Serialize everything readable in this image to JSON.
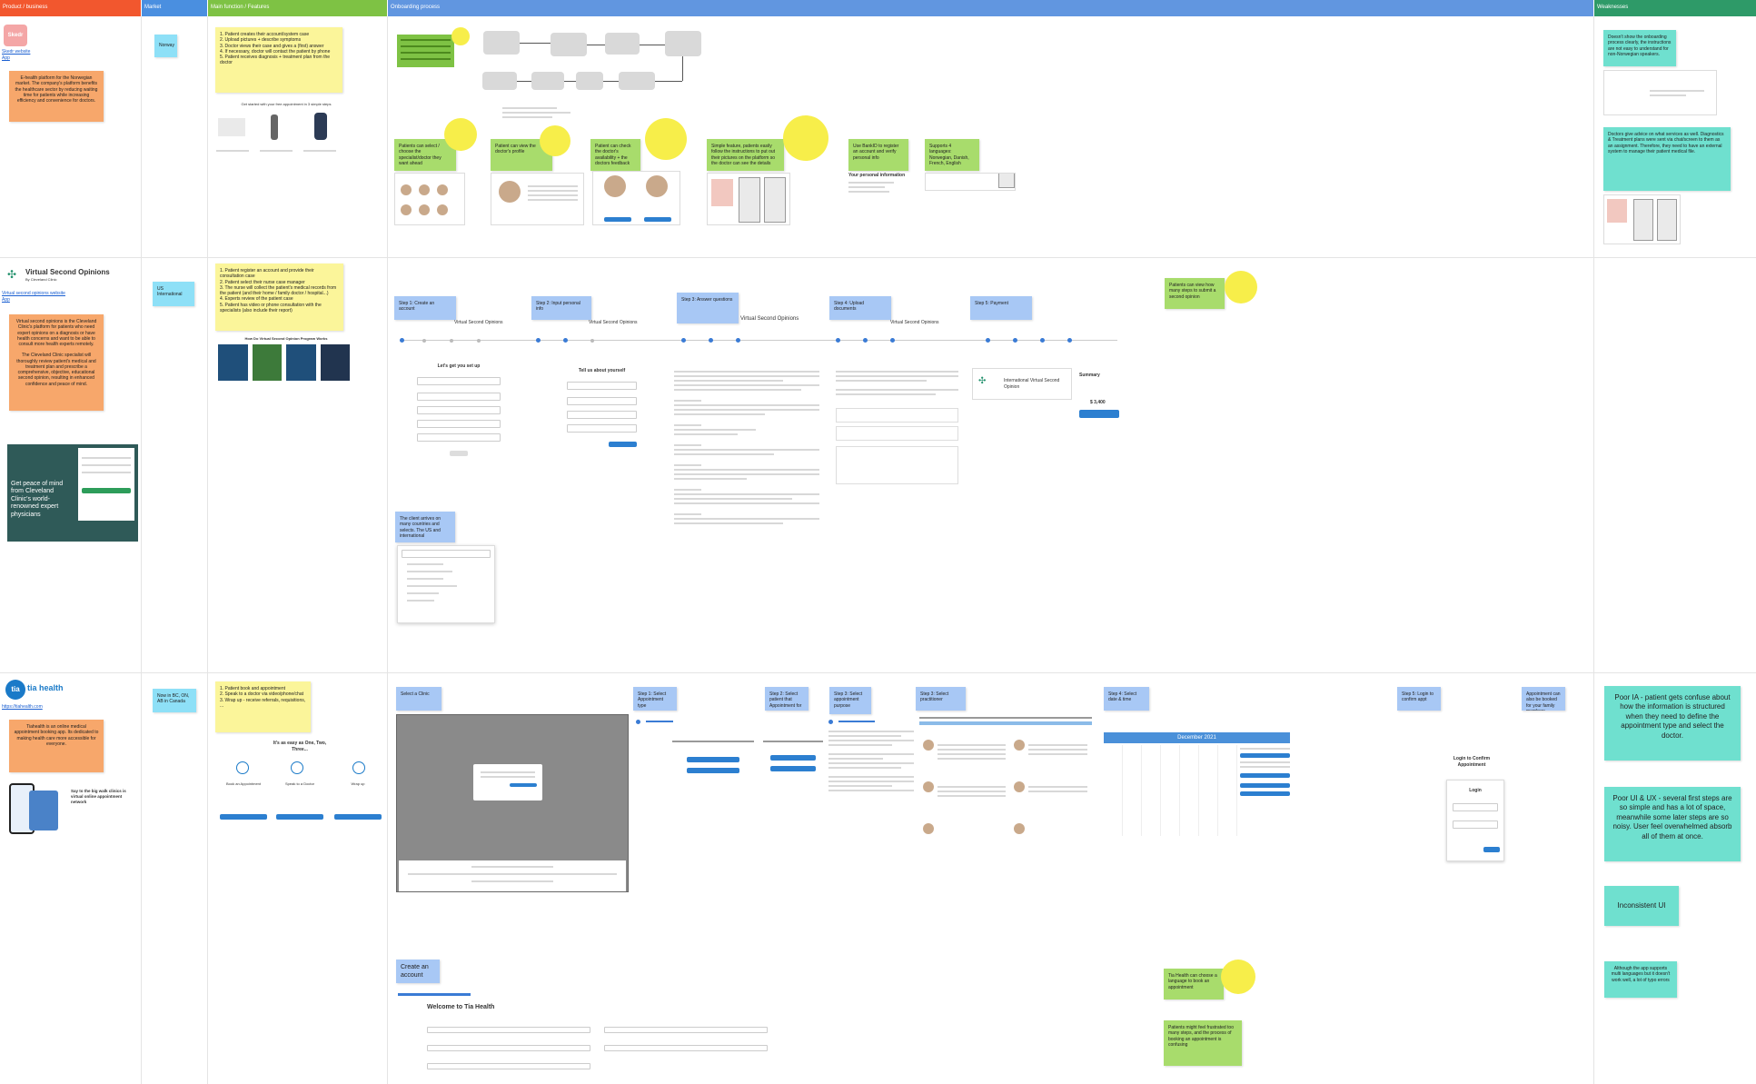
{
  "columns": [
    {
      "label": "Product / business",
      "color": "#f2572e"
    },
    {
      "label": "Market",
      "color": "#4a8fe0"
    },
    {
      "label": "Main function / Features",
      "color": "#7ec244"
    },
    {
      "label": "Onboarding process",
      "color": "#6196e0"
    },
    {
      "label": "Weaknesses",
      "color": "#2e9a68"
    }
  ],
  "row1": {
    "logo_text": "Skedr",
    "link1": "Skedr website",
    "link2": "App",
    "description": "E-health platform for the Norwegian market. The company's platform benefits the healthcare sector by reducing waiting time for patients while increasing efficiency and convenience for doctors.",
    "market": "Norway",
    "features": "1. Patient creates their account/system case\n2. Upload pictures + describe symptoms\n3. Doctor views their case and gives a (first) answer\n4. If necessary, doctor will contact the patient by phone\n5. Patient receives diagnosis + treatment plan from the doctor",
    "features_caption": "Get started with your free appointment in 3 simple steps",
    "note_select": "Patients can select / choose the specialist/doctor they want ahead",
    "note_profile": "Patient can view the doctor's profile",
    "note_doctors": "Patient can check the doctor's availability + the doctors feedback",
    "note_photos": "Simple feature, patients easily follow the instructions to put out their pictures on the platform so the doctor can see the details",
    "note_bankid": "Use BankID to register an account and verify personal info",
    "note_languages": "Supports 4 languages: Norwegian, Danish, French, English",
    "personal_info_title": "Your personal information",
    "weakness1": "Doesn't show the onboarding process clearly, the instructions are not easy to understand for non-Norwegian speakers.",
    "weakness2": "Doctors give advice on what services as well. Diagnostics & Treatment plans were sent via chat/screen to them as an assignment. Therefore, they need to have an external system to manage their patient medical file."
  },
  "row2": {
    "name": "Virtual Second Opinions",
    "sub": "By Cleveland Clinic",
    "link1": "Virtual second opinions website",
    "link2": "App",
    "description": "Virtual second opinions is the Cleveland Clinic's platform for patients who need expert opinions on a diagnosis or have health concerns and want to be able to consult more health experts remotely.",
    "description2": "The Cleveland Clinic specialist will thoroughly review patient's medical and treatment plan and prescribe a comprehensive, objective, educational second opinion, resulting in enhanced confidence and peace of mind.",
    "market": "US\nInternational",
    "features": "1. Patient register an account and provide their consultation case\n2. Patient select their nurse case manager\n3. The nurse will collect the patient's medical records from the patient (and their home / family doctor / hospital...)\n4. Experts review of the patient case\n5. Patient has video or phone consultation with the specialists (also include their report)",
    "features_caption": "How Do Virtual Second Opinion Program Works",
    "promo_text": "Get peace of mind from Cleveland Clinic's world-renowned expert physicians",
    "steps": [
      "Step 1: Create an account",
      "Step 2: Input personal info",
      "Step 3: Answer questions",
      "Step 4: Upload documents",
      "Step 5: Payment"
    ],
    "panel_title": "Virtual Second Opinions",
    "signup_title": "Let's get you set up",
    "about_title": "Tell us about yourself",
    "note_country": "The client arrives on many countries and selects. The US and international",
    "note_pay": "Patients can view how many steps to submit a second opinion",
    "pay_name": "International Virtual Second Opinion",
    "pay_total": "Summary",
    "pay_amount": "$ 3,400"
  },
  "row3": {
    "name": "tia health",
    "link": "https://tiahealth.com",
    "description": "Tiahealth is an online medical appointment booking app. Its dedicated to making health care more accessible for everyone.",
    "promo_text": "Say to the big walk clinics is virtual online appointment network",
    "market": "Now in BC, ON, AB in Canada",
    "features": "1. Patient book and appointment\n2. Speak to a doctor via video/phone/chat\n3. Wrap up - receive referrals, requisitions, ...",
    "features_caption": "It's as easy as One, Two, Three...",
    "feature_cards": [
      "Book an Appointment",
      "Speak to a Doctor",
      "Wrap up"
    ],
    "step_labels": [
      "Select a Clinic",
      "Step 1: Select Appointment type",
      "Step 2: Select patient that Appointment for",
      "Step 3: Select appointment purpose",
      "Step 3: Select practitioner",
      "Step 4: Select date & time",
      "Step 5: Login to confirm appt"
    ],
    "note_create": "Create an account",
    "note_payment": "Appointment can also be booked for your family members",
    "welcome": "Welcome to Tia Health",
    "calendar_month": "December 2021",
    "login_title": "Login",
    "login_head": "Login to Confirm Appointment",
    "note_language": "Tia Health can choose a language to book an appointment",
    "note_patient": "Patients might feel frustrated too many steps, and the process of booking an appointment is confusing",
    "weakness1": "Poor IA - patient gets confuse about how the information is structured when they need to define the appointment type and select the doctor.",
    "weakness2": "Poor UI & UX - several first steps are so simple and has a lot of space, meanwhile some later steps are so noisy. User feel overwhelmed absorb all of them at once.",
    "weakness3": "Inconsistent UI",
    "weakness4": "Although the app supports multi languages but it doesn't work well, a lot of typo errors"
  }
}
